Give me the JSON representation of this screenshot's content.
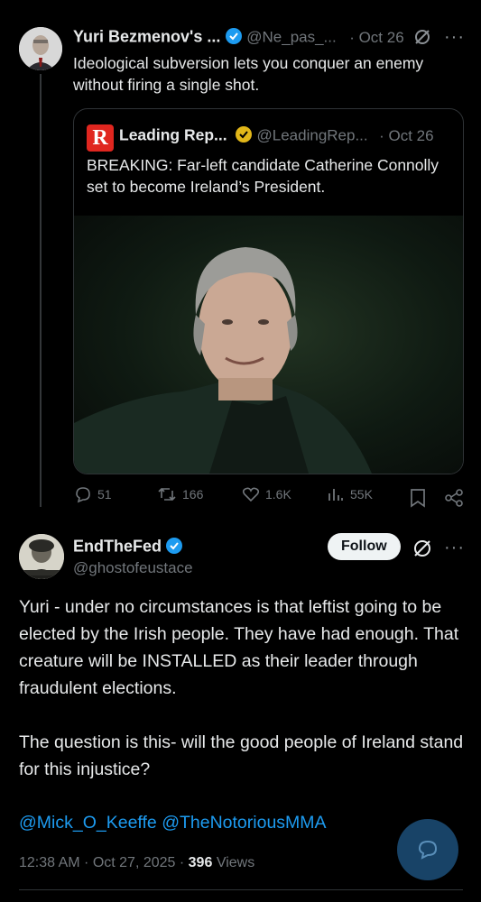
{
  "parent_tweet": {
    "display_name": "Yuri Bezmenov's ...",
    "handle": "@Ne_pas_...",
    "date": "· Oct 26",
    "text": "Ideological subversion lets you conquer an enemy without firing a single shot."
  },
  "quote_tweet": {
    "display_name": "Leading Rep...",
    "handle": "@LeadingRep...",
    "date": "· Oct 26",
    "text": "BREAKING: Far-left candidate Catherine Connolly set to become Ireland’s President.",
    "logo_letter": "R"
  },
  "actions": {
    "replies": "51",
    "reposts": "166",
    "likes": "1.6K",
    "views": "55K"
  },
  "main_tweet": {
    "display_name": "EndTheFed",
    "handle": "@ghostofeustace",
    "follow_label": "Follow",
    "paragraph1": "Yuri - under no circumstances is that leftist going to be elected by the Irish people. They have had enough. That creature will be INSTALLED as their leader through fraudulent elections.",
    "paragraph2": "The question is this- will the good people of Ireland stand for this injustice?",
    "mention1": "@Mick_O_Keeffe",
    "mention2": "@TheNotoriousMMA",
    "timestamp": "12:38 AM · Oct 27, 2025 · ",
    "views_count": "396",
    "views_label": "Views"
  },
  "colors": {
    "accent": "#1d9bf0",
    "verified_gold": "#e2b719",
    "logo_red": "#e0261f"
  }
}
